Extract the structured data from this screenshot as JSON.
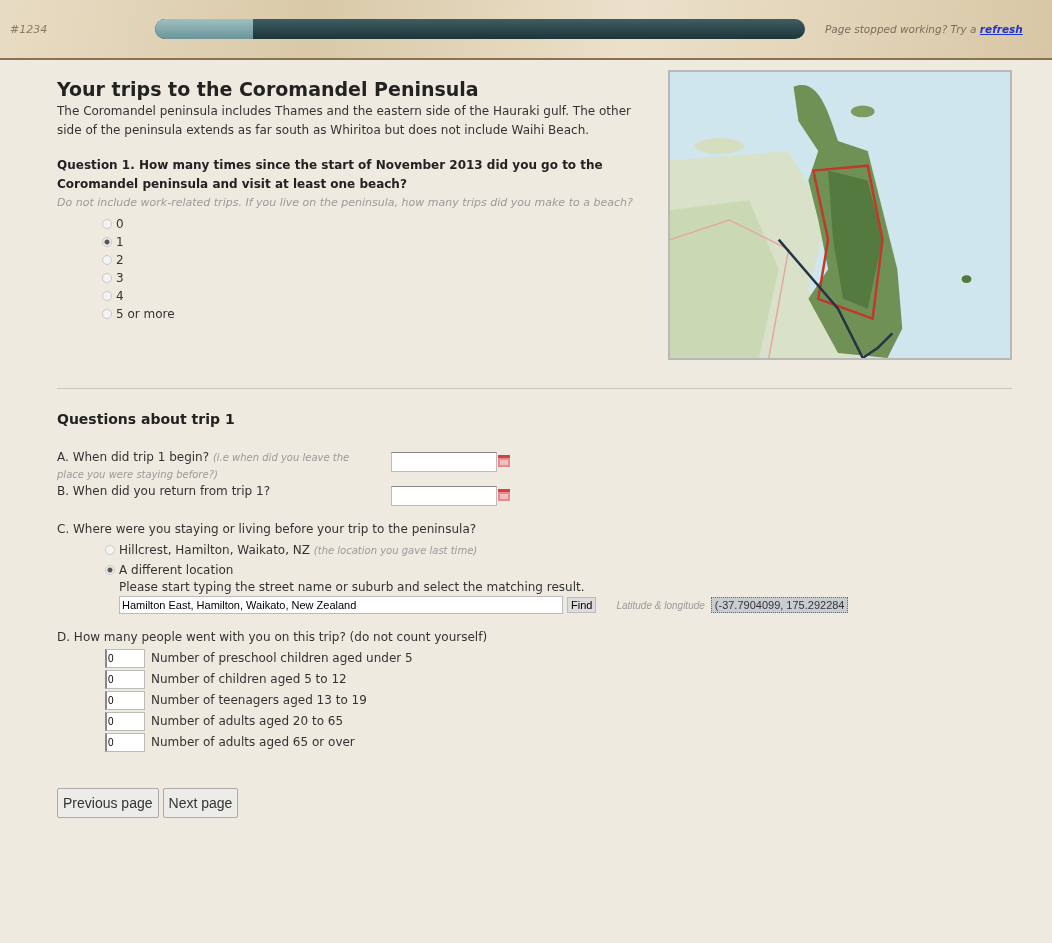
{
  "header": {
    "survey_id": "#1234",
    "progress": {
      "level": 0.15
    },
    "help_text": "Page stopped working? Try a ",
    "help_link": "refresh"
  },
  "intro": {
    "title": "Your trips to the Coromandel Peninsula",
    "description": "The Coromandel peninsula includes Thames and the eastern side of the Hauraki gulf. The other side of the peninsula extends as far south as Whiritoa but does not include Waihi Beach."
  },
  "question_1": {
    "text": "Question 1. How many times since the start of November 2013 did you go to the Coromandel peninsula and visit at least one beach?",
    "hint": "Do not include work-related trips. If you live on the peninsula, how many trips did you make to a beach?",
    "options": [
      {
        "label": "0",
        "selected": false
      },
      {
        "label": "1",
        "selected": true
      },
      {
        "label": "2",
        "selected": false
      },
      {
        "label": "3",
        "selected": false
      },
      {
        "label": "4",
        "selected": false
      },
      {
        "label": "5 or more",
        "selected": false
      }
    ]
  },
  "trip": {
    "title": "Questions about trip 1",
    "dates": [
      {
        "label": "A. When did trip 1 begin?",
        "hint": "(i.e when did you leave the place you were staying before?)"
      },
      {
        "label": "B. When did you return from trip 1?"
      }
    ],
    "location": {
      "question": "C. Where were you staying or living before your trip to the peninsula?",
      "options": [
        {
          "label": "Hillcrest, Hamilton, Waikato, NZ",
          "hint": "(the location you gave last time)",
          "selected": false
        },
        {
          "label": "A different location",
          "selected": true
        }
      ],
      "instruction": "Please start typing the street name or suburb and select the matching result.",
      "search_value": "Hamilton East, Hamilton, Waikato, New Zealand",
      "find_button": "Find",
      "coords_label": "Latitude & longitude",
      "coords_value": "(-37.7904099, 175.292284"
    },
    "people": {
      "question": "D. How many people went with you on this trip? (do not count yourself)",
      "counts": [
        {
          "value": "0",
          "label": "Number of preschool children aged under 5"
        },
        {
          "value": "0",
          "label": "Number of children aged 5 to 12"
        },
        {
          "value": "0",
          "label": "Number of teenagers aged 13 to 19"
        },
        {
          "value": "0",
          "label": "Number of adults aged 20 to 65"
        },
        {
          "value": "0",
          "label": "Number of adults aged 65 or over"
        }
      ]
    }
  },
  "buttons": [
    "Previous page",
    "Next page"
  ]
}
